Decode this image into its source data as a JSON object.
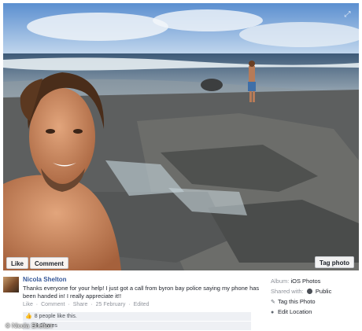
{
  "photo": {
    "like_label": "Like",
    "comment_label": "Comment",
    "tag_label": "Tag photo",
    "expand_icon": "expand-icon"
  },
  "post": {
    "author": "Nicola Shelton",
    "text": "Thanks everyone for your help! I just got a call from byron bay police saying my phone has been handed in! I really appreciate it!!",
    "actions": [
      "Like",
      "Comment",
      "Share"
    ],
    "separator": "·",
    "date": "25 February",
    "edited": "Edited",
    "likes": "8 people like this.",
    "shares": "14 Shares"
  },
  "sidebar": {
    "album_label": "Album:",
    "album_value": "iOS Photos",
    "shared_label": "Shared with:",
    "shared_value": "Public",
    "tag_this_photo": "Tag this Photo",
    "edit_location": "Edit Location"
  },
  "watermark": "© Nicola Shelton",
  "colors": {
    "link": "#365899",
    "meta": "#90949c",
    "accent": "#4267b2"
  }
}
